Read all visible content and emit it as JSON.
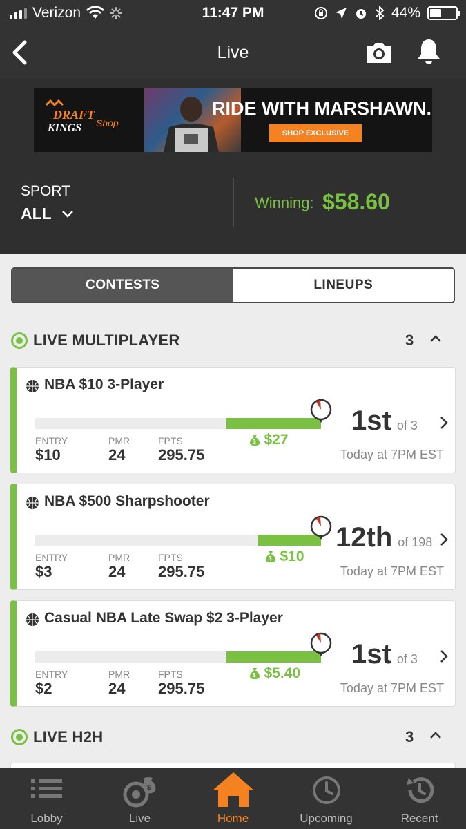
{
  "status_bar": {
    "carrier": "Verizon",
    "time": "11:47 PM",
    "battery": "44%"
  },
  "nav": {
    "title": "Live"
  },
  "banner": {
    "brand": "DRAFT KINGS",
    "brand_sub": "Shop",
    "headline": "RIDE WITH MARSHAWN.",
    "cta": "SHOP EXCLUSIVE"
  },
  "filters": {
    "sport_label": "SPORT",
    "sport_value": "ALL",
    "winning_label": "Winning:",
    "winning_value": "$58.60"
  },
  "tabs": {
    "contests": "CONTESTS",
    "lineups": "LINEUPS"
  },
  "sections": {
    "multiplayer": {
      "title": "LIVE MULTIPLAYER",
      "count": "3"
    },
    "h2h": {
      "title": "LIVE H2H",
      "count": "3"
    }
  },
  "stat_labels": {
    "entry": "ENTRY",
    "pmr": "PMR",
    "fpts": "FPTS"
  },
  "contests": [
    {
      "name": "NBA $10 3-Player",
      "entry": "$10",
      "pmr": "24",
      "fpts": "295.75",
      "winnings": "$27",
      "rank": "1st",
      "of": "of 3",
      "time": "Today at 7PM EST",
      "progress": 0.33
    },
    {
      "name": "NBA $500 Sharpshooter",
      "entry": "$3",
      "pmr": "24",
      "fpts": "295.75",
      "winnings": "$10",
      "rank": "12th",
      "of": "of 198",
      "time": "Today at 7PM EST",
      "progress": 0.22
    },
    {
      "name": "Casual NBA Late Swap $2 3-Player",
      "entry": "$2",
      "pmr": "24",
      "fpts": "295.75",
      "winnings": "$5.40",
      "rank": "1st",
      "of": "of 3",
      "time": "Today at 7PM EST",
      "progress": 0.33
    }
  ],
  "tabbar": {
    "lobby": "Lobby",
    "live": "Live",
    "home": "Home",
    "upcoming": "Upcoming",
    "recent": "Recent"
  },
  "colors": {
    "accent_green": "#7ac143",
    "accent_orange": "#f58220",
    "dark_bar": "#333333"
  }
}
